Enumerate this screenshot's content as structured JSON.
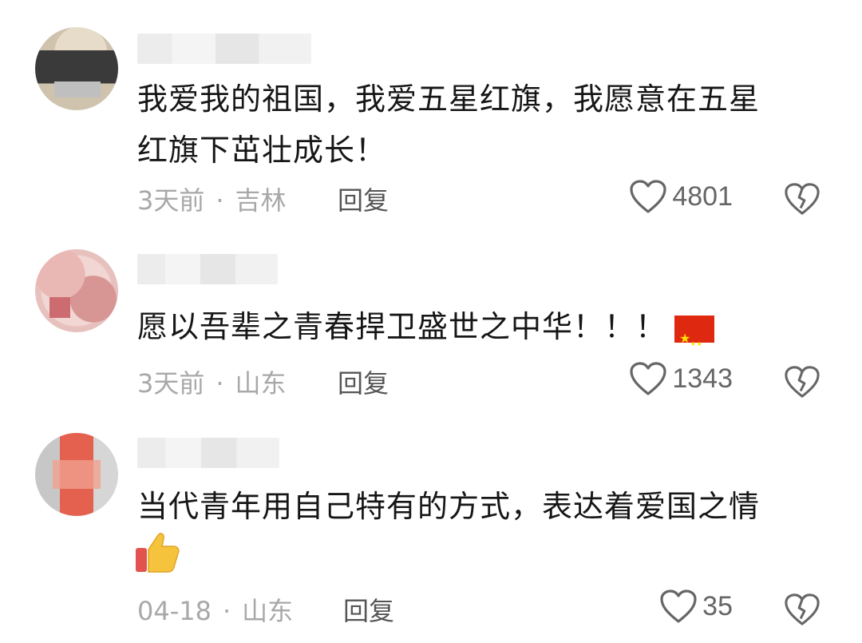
{
  "comments": [
    {
      "text_line1": "我爱我的祖国，我爱五星红旗，我愿意在五星",
      "text_line2": "红旗下茁壮成长！",
      "time": "3天前",
      "separator": "·",
      "location": "吉林",
      "reply_label": "回复",
      "likes": "4801"
    },
    {
      "text": "愿以吾辈之青春捍卫盛世之中华！！！",
      "emoji": "china-flag-emoji",
      "time": "3天前",
      "separator": "·",
      "location": "山东",
      "reply_label": "回复",
      "likes": "1343"
    },
    {
      "text": "当代青年用自己特有的方式，表达着爱国之情",
      "emoji": "thumbs-up-emoji",
      "time": "04-18",
      "separator": "·",
      "location": "山东",
      "reply_label": "回复",
      "likes": "35"
    }
  ],
  "colors": {
    "text": "#161616",
    "meta": "#a8a8a8",
    "reply": "#555555",
    "icon": "#666666",
    "flag_red": "#de2910",
    "flag_star": "#ffde00"
  }
}
